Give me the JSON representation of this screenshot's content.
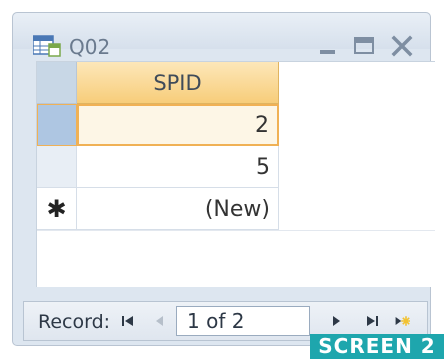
{
  "window": {
    "title": "Q02",
    "icon": "table-query-icon",
    "controls": [
      "minimize-icon",
      "maximize-icon",
      "close-icon"
    ]
  },
  "datasheet": {
    "column_header": "SPID",
    "rows": [
      {
        "selector": "",
        "value": "2"
      },
      {
        "selector": "",
        "value": "5"
      },
      {
        "selector": "✱",
        "value": "(New)"
      }
    ]
  },
  "navigation": {
    "label": "Record:",
    "record_position": "1 of 2",
    "buttons": [
      "first-record-icon",
      "previous-record-icon",
      "next-record-icon",
      "last-record-icon",
      "new-record-icon"
    ]
  },
  "banner": {
    "text": "SCREEN 2"
  },
  "colors": {
    "header_accent": "#f7cd7a",
    "active_border": "#f0b155",
    "banner": "#1ea6ad"
  }
}
